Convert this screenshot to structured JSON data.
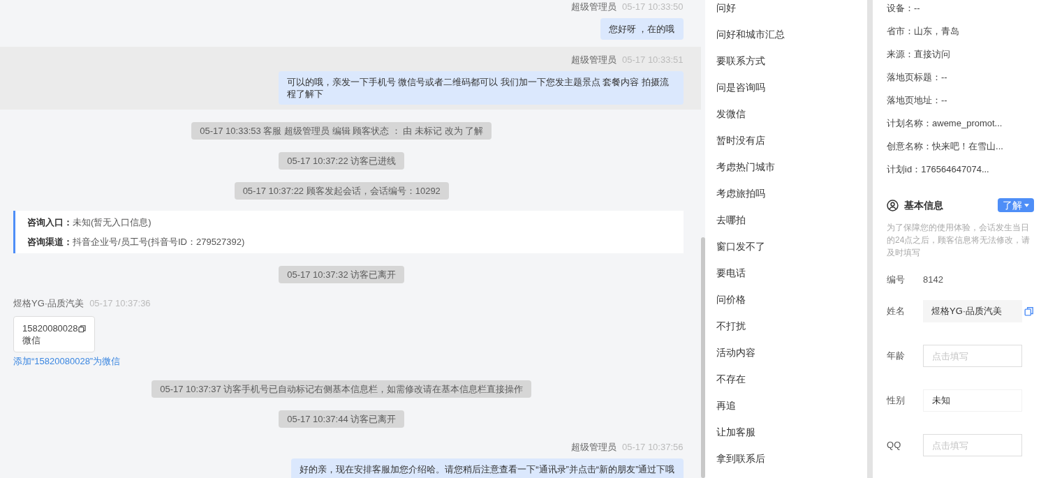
{
  "chat": {
    "messages": [
      {
        "kind": "agent",
        "name": "超级管理员",
        "time": "05-17 10:33:50",
        "text": "您好呀 ，在的哦",
        "highlighted": false
      },
      {
        "kind": "agent",
        "name": "超级管理员",
        "time": "05-17 10:33:51",
        "text": "可以的哦，亲发一下手机号 微信号或者二维码都可以 我们加一下您发主题景点 套餐内容 拍摄流程了解下",
        "highlighted": true
      },
      {
        "kind": "system",
        "text": "05-17 10:33:53 客服 超级管理员 编辑 顾客状态 ： 由 未标记 改为 了解"
      },
      {
        "kind": "system",
        "text": "05-17 10:37:22 访客已进线"
      },
      {
        "kind": "system",
        "text": "05-17 10:37:22 顾客发起会话，会话编号：10292"
      },
      {
        "kind": "entry",
        "lines": [
          {
            "label": "咨询入口：",
            "value": "未知(暂无入口信息)"
          },
          {
            "label": "咨询渠道：",
            "value": "抖音企业号/员工号(抖音号ID：279527392)"
          }
        ]
      },
      {
        "kind": "system",
        "text": "05-17 10:37:32 访客已离开"
      },
      {
        "kind": "visitor",
        "name": "煜格YG·品质汽美",
        "time": "05-17 10:37:36",
        "card": {
          "number": "15820080028",
          "type": "微信"
        },
        "link": "添加“15820080028”为微信"
      },
      {
        "kind": "system",
        "text": "05-17 10:37:37 访客手机号已自动标记右侧基本信息栏，如需修改请在基本信息栏直接操作"
      },
      {
        "kind": "system",
        "text": "05-17 10:37:44 访客已离开"
      },
      {
        "kind": "agent",
        "name": "超级管理员",
        "time": "05-17 10:37:56",
        "text": "好的亲，现在安排客服加您介绍哈。请您稍后注意查看一下“通讯录”并点击“新的朋友”通过下哦",
        "highlighted": false
      }
    ]
  },
  "quick_replies": [
    "问好",
    "问好和城市汇总",
    "要联系方式",
    "问是咨询吗",
    "发微信",
    "暂时没有店",
    "考虑热门城市",
    "考虑旅拍吗",
    "去哪拍",
    "窗口发不了",
    "要电话",
    "问价格",
    "不打扰",
    "活动内容",
    "不存在",
    "再追",
    "让加客服",
    "拿到联系后"
  ],
  "visitor_info": [
    "设备：--",
    "省市：山东，青岛",
    "来源：直接访问",
    "落地页标题：--",
    "落地页地址：--",
    "计划名称：aweme_promot...",
    "创意名称：快来吧！在雪山...",
    "计划id：176564647074..."
  ],
  "basic_info": {
    "title": "基本信息",
    "status": "了解",
    "note": "为了保障您的使用体验，会话发生当日的24点之后，顾客信息将无法修改，请及时填写",
    "fields": [
      {
        "kind": "static",
        "label": "编号",
        "value": "8142"
      },
      {
        "kind": "readonly",
        "label": "姓名",
        "value": "煜格YG·品质汽美"
      },
      {
        "kind": "input",
        "label": "年龄",
        "placeholder": "点击填写"
      },
      {
        "kind": "select",
        "label": "性别",
        "value": "未知"
      },
      {
        "kind": "input",
        "label": "QQ",
        "placeholder": "点击填写"
      }
    ]
  }
}
